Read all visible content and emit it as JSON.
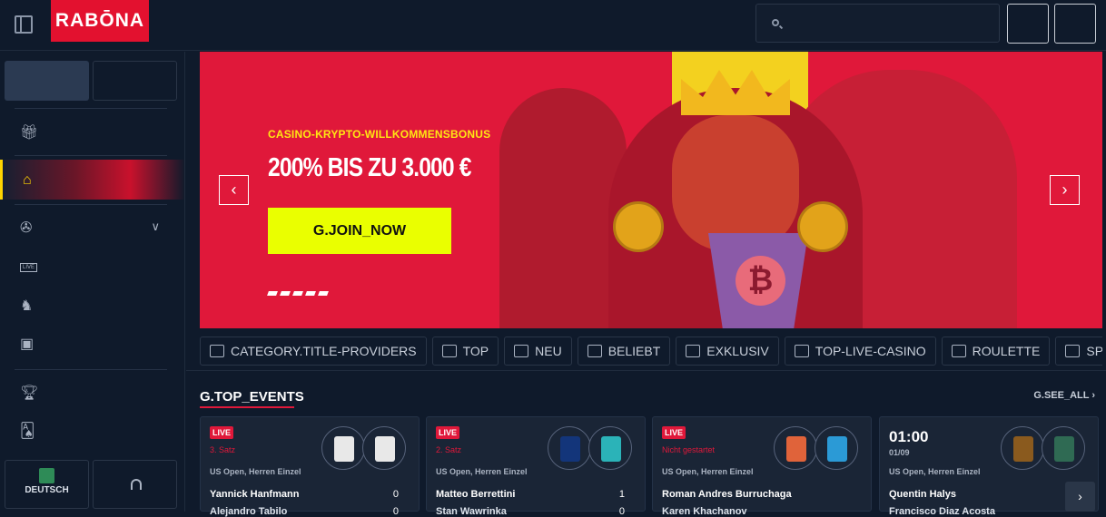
{
  "header": {
    "logo": "RABŌNA",
    "search": {
      "placeholder": ""
    }
  },
  "sidebar": {
    "bottom": {
      "language": "DEUTSCH"
    }
  },
  "banner": {
    "subtitle": "CASINO-KRYPTO-WILLKOMMENSBONUS",
    "title": "200% BIS ZU 3.000 €",
    "cta": "G.JOIN_NOW",
    "prev": "‹",
    "next": "›"
  },
  "categories": [
    {
      "label": "CATEGORY.TITLE-PROVIDERS",
      "icon": "folder-icon"
    },
    {
      "label": "TOP",
      "icon": "crown-icon"
    },
    {
      "label": "NEU",
      "icon": "star-icon"
    },
    {
      "label": "BELIEBT",
      "icon": "flame-icon"
    },
    {
      "label": "EXKLUSIV",
      "icon": "diamond-icon"
    },
    {
      "label": "TOP-LIVE-CASINO",
      "icon": "crown-icon"
    },
    {
      "label": "ROULETTE",
      "icon": "roulette-icon"
    },
    {
      "label": "SPIELSHOWS",
      "icon": "microphone-icon"
    }
  ],
  "top_events": {
    "title": "G.TOP_EVENTS",
    "see_all": "G.SEE_ALL",
    "cards": [
      {
        "badge": "LIVE",
        "status": "3. Satz",
        "league": "US Open, Herren Einzel",
        "player1": "Yannick Hanfmann",
        "score1": "0",
        "player2": "Alejandro Tabilo",
        "score2": "0",
        "colors": [
          "#e8e8e8",
          "#e8e8e8"
        ]
      },
      {
        "badge": "LIVE",
        "status": "2. Satz",
        "league": "US Open, Herren Einzel",
        "player1": "Matteo Berrettini",
        "score1": "1",
        "player2": "Stan Wawrinka",
        "score2": "0",
        "colors": [
          "#13357a",
          "#2bb3b8"
        ]
      },
      {
        "badge": "LIVE",
        "status": "Nicht gestartet",
        "league": "US Open, Herren Einzel",
        "player1": "Roman Andres Burruchaga",
        "score1": "",
        "player2": "Karen Khachanov",
        "score2": "",
        "colors": [
          "#e0633a",
          "#2b9ad6"
        ]
      },
      {
        "time": "01:00",
        "date": "01/09",
        "league": "US Open, Herren Einzel",
        "player1": "Quentin Halys",
        "player2": "Francisco Diaz Acosta",
        "colors": [
          "#8a5a1e",
          "#2f6a53"
        ]
      }
    ],
    "next": "›"
  }
}
